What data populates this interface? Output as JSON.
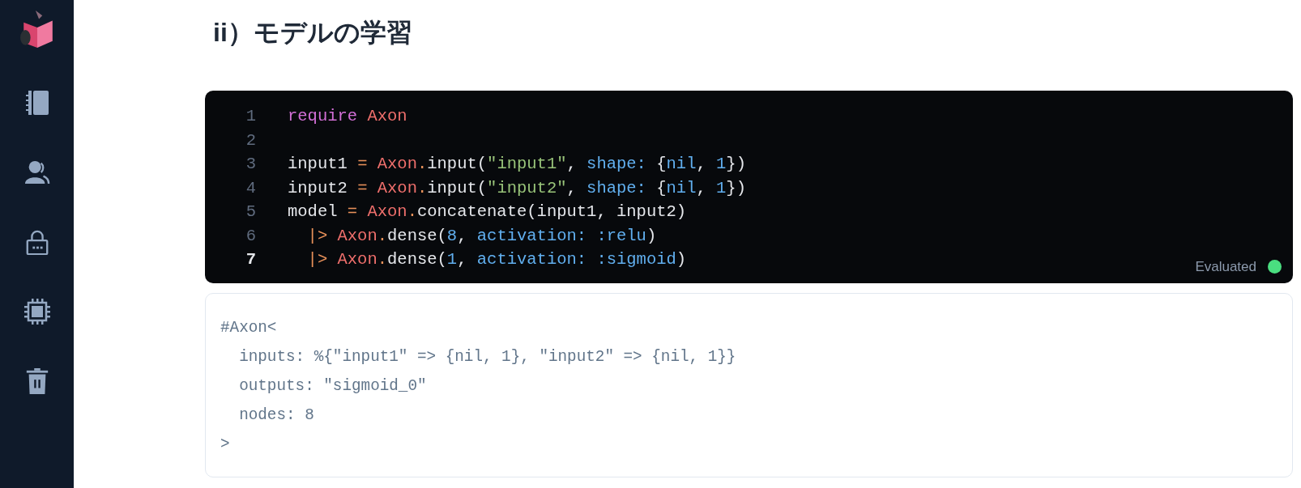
{
  "sidebar": {
    "items": [
      {
        "kind": "logo"
      },
      {
        "kind": "notebook"
      },
      {
        "kind": "users"
      },
      {
        "kind": "lock"
      },
      {
        "kind": "chip"
      },
      {
        "kind": "trash"
      }
    ]
  },
  "heading": "ii）モデルの学習",
  "code_cell": {
    "lines": [
      {
        "number": "1",
        "active": false,
        "tokens": [
          {
            "kind": "keyword",
            "text": "require"
          },
          {
            "kind": "module",
            "text": " Axon"
          }
        ]
      },
      {
        "number": "2",
        "active": false
      },
      {
        "number": "3",
        "active": false,
        "tokens": [
          {
            "kind": "plain",
            "text": "input1 "
          },
          {
            "kind": "operator",
            "text": "= "
          },
          {
            "kind": "module",
            "text": "Axon"
          },
          {
            "kind": "operator",
            "text": "."
          },
          {
            "kind": "plain",
            "text": "input("
          },
          {
            "kind": "string",
            "text": "\"input1\""
          },
          {
            "kind": "plain",
            "text": ", "
          },
          {
            "kind": "atom",
            "text": "shape:"
          },
          {
            "kind": "plain",
            "text": " {"
          },
          {
            "kind": "atom",
            "text": "nil"
          },
          {
            "kind": "plain",
            "text": ", "
          },
          {
            "kind": "atom",
            "text": "1"
          },
          {
            "kind": "plain",
            "text": "})"
          }
        ]
      },
      {
        "number": "4",
        "active": false,
        "tokens": [
          {
            "kind": "plain",
            "text": "input2 "
          },
          {
            "kind": "operator",
            "text": "= "
          },
          {
            "kind": "module",
            "text": "Axon"
          },
          {
            "kind": "operator",
            "text": "."
          },
          {
            "kind": "plain",
            "text": "input("
          },
          {
            "kind": "string",
            "text": "\"input2\""
          },
          {
            "kind": "plain",
            "text": ", "
          },
          {
            "kind": "atom",
            "text": "shape:"
          },
          {
            "kind": "plain",
            "text": " {"
          },
          {
            "kind": "atom",
            "text": "nil"
          },
          {
            "kind": "plain",
            "text": ", "
          },
          {
            "kind": "atom",
            "text": "1"
          },
          {
            "kind": "plain",
            "text": "})"
          }
        ]
      },
      {
        "number": "5",
        "active": false,
        "tokens": [
          {
            "kind": "plain",
            "text": "model "
          },
          {
            "kind": "operator",
            "text": "= "
          },
          {
            "kind": "module",
            "text": "Axon"
          },
          {
            "kind": "operator",
            "text": "."
          },
          {
            "kind": "plain",
            "text": "concatenate(input1, input2)"
          }
        ]
      },
      {
        "number": "6",
        "active": false,
        "tokens": [
          {
            "kind": "pipe",
            "text": "  |> "
          },
          {
            "kind": "module",
            "text": "Axon"
          },
          {
            "kind": "operator",
            "text": "."
          },
          {
            "kind": "plain",
            "text": "dense("
          },
          {
            "kind": "atom",
            "text": "8"
          },
          {
            "kind": "plain",
            "text": ", "
          },
          {
            "kind": "atom",
            "text": "activation: :relu"
          },
          {
            "kind": "plain",
            "text": ")"
          }
        ]
      },
      {
        "number": "7",
        "active": true,
        "tokens": [
          {
            "kind": "pipe",
            "text": "  |> "
          },
          {
            "kind": "module",
            "text": "Axon"
          },
          {
            "kind": "operator",
            "text": "."
          },
          {
            "kind": "plain",
            "text": "dense("
          },
          {
            "kind": "atom",
            "text": "1"
          },
          {
            "kind": "plain",
            "text": ", "
          },
          {
            "kind": "atom",
            "text": "activation: :sigmoid"
          },
          {
            "kind": "plain",
            "text": ")"
          }
        ]
      }
    ],
    "status": {
      "label": "Evaluated",
      "kind": "evaluated"
    }
  },
  "output": {
    "lines": [
      "#Axon<",
      "  inputs: %{\"input1\" => {nil, 1}, \"input2\" => {nil, 1}}",
      "  outputs: \"sigmoid_0\"",
      "  nodes: 8",
      ">"
    ]
  }
}
